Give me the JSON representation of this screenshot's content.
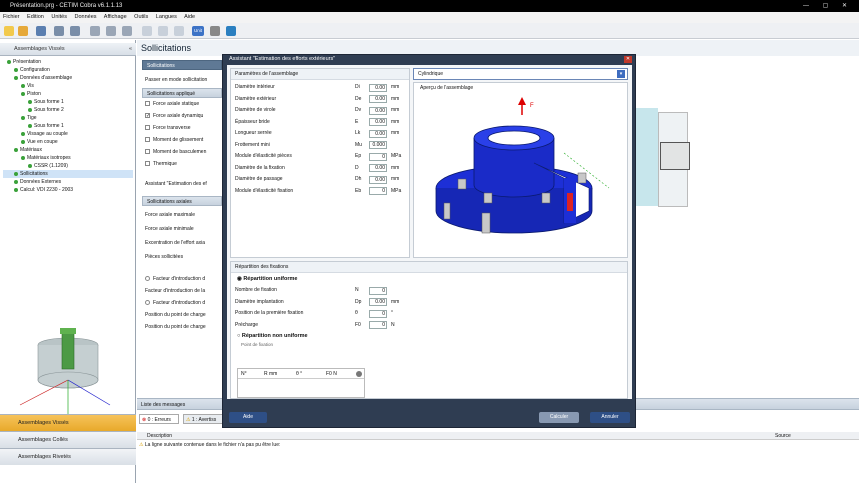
{
  "window": {
    "title": "Présentation.prg - CETIM Cobra v6.1.1.13"
  },
  "menu": [
    "Fichier",
    "Edition",
    "Unités",
    "Données",
    "Affichage",
    "Outils",
    "Langues",
    "Aide"
  ],
  "toolbar": {
    "unit_label": "Unit"
  },
  "left_panel": {
    "header": "Assemblages Vissés",
    "tree": [
      {
        "label": "Présentation",
        "level": 0
      },
      {
        "label": "Configuration",
        "level": 1
      },
      {
        "label": "Données d'assemblage",
        "level": 1
      },
      {
        "label": "Vis",
        "level": 2
      },
      {
        "label": "Piston",
        "level": 2
      },
      {
        "label": "Sous forme 1",
        "level": 3
      },
      {
        "label": "Sous forme 2",
        "level": 3
      },
      {
        "label": "Tige",
        "level": 2
      },
      {
        "label": "Sous forme 1",
        "level": 3
      },
      {
        "label": "Vissage au couple",
        "level": 2
      },
      {
        "label": "Vue en coupe",
        "level": 2
      },
      {
        "label": "Matériaux",
        "level": 1
      },
      {
        "label": "Matériaux isotropes",
        "level": 2
      },
      {
        "label": "CSSR (1.1209)",
        "level": 3
      },
      {
        "label": "Sollicitations",
        "level": 1
      },
      {
        "label": "Données Externes",
        "level": 1
      },
      {
        "label": "Calcul: VDI 2230 - 2003",
        "level": 1
      }
    ],
    "nav": [
      "Assemblages Vissés",
      "Assemblages Collés",
      "Assemblages Rivetés"
    ]
  },
  "main": {
    "title": "Sollicitations",
    "sub_header": "Sollicitations",
    "mode_text": "Passer en mode sollicitation",
    "applied_header": "Sollicitations appliqué",
    "applied": [
      {
        "label": "Force axiale statique",
        "checked": false
      },
      {
        "label": "Force axiale dynamiqu",
        "checked": true
      },
      {
        "label": "Force transverse",
        "checked": false
      },
      {
        "label": "Moment de glissement",
        "checked": false
      },
      {
        "label": "Moment de basculemen",
        "checked": false
      },
      {
        "label": "Thermique",
        "checked": false
      }
    ],
    "assistant_text": "Assistant \"Estimation des ef",
    "axial_header": "Sollicitations axiales",
    "axial": [
      "Force axiale maximale",
      "Force axiale minimale",
      "Excentration de l'effort axia",
      "Pièces sollicitées"
    ],
    "intro": [
      "Facteur d'introduction d",
      "Facteur d'introduction de la",
      "Facteur d'introduction d",
      "Position du point de charge",
      "Position du point de charge"
    ]
  },
  "messages": {
    "header": "Liste des messages",
    "tabs": [
      "0 : Erreurs",
      "1 : Avertiss"
    ],
    "col_desc": "Description",
    "col_source": "Source",
    "rows": [
      "La ligne suivante contenue dans le fichier n'a pas pu être lue:"
    ]
  },
  "dialog": {
    "title": "Assistant \"Estimation des efforts extérieurs\"",
    "params_header": "Paramètres de l'assemblage",
    "params": [
      {
        "label": "Diamètre intérieur",
        "sym": "Di",
        "val": "0.00",
        "unit": "mm"
      },
      {
        "label": "Diamètre extérieur",
        "sym": "De",
        "val": "0.00",
        "unit": "mm"
      },
      {
        "label": "Diamètre de virole",
        "sym": "Dv",
        "val": "0.00",
        "unit": "mm"
      },
      {
        "label": "Épaisseur bride",
        "sym": "E",
        "val": "0.00",
        "unit": "mm"
      },
      {
        "label": "Longueur serrée",
        "sym": "Lk",
        "val": "0.00",
        "unit": "mm"
      },
      {
        "label": "Frottement mini",
        "sym": "Mu",
        "val": "0.000",
        "unit": ""
      },
      {
        "label": "Module d'élasticité pièces",
        "sym": "Ep",
        "val": "0",
        "unit": "MPa"
      },
      {
        "label": "Diamètre de la fixation",
        "sym": "D",
        "val": "0.00",
        "unit": "mm"
      },
      {
        "label": "Diamètre de passage",
        "sym": "Dh",
        "val": "0.00",
        "unit": "mm"
      },
      {
        "label": "Module d'élasticité fixation",
        "sym": "Eb",
        "val": "0",
        "unit": "MPa"
      }
    ],
    "shape_select": "Cylindrique",
    "preview_label": "Aperçu de l'assemblage",
    "dist_header": "Répartition des fixations",
    "uniform_label": "Répartition uniforme",
    "uniform": [
      {
        "label": "Nombre de fixation",
        "sym": "N",
        "val": "0",
        "unit": ""
      },
      {
        "label": "Diamètre implantation",
        "sym": "Dp",
        "val": "0.00",
        "unit": "mm"
      },
      {
        "label": "Position de la première fixation",
        "sym": "θ",
        "val": "0",
        "unit": "°"
      },
      {
        "label": "Précharge",
        "sym": "F0",
        "val": "0",
        "unit": "N"
      }
    ],
    "nonuniform_label": "Répartition non uniforme",
    "point_label": "Point de fixation",
    "grid_cols": [
      "N°",
      "R mm",
      "θ °",
      "F0 N"
    ],
    "buttons": {
      "help": "Aide",
      "calc": "Calculer",
      "cancel": "Annuler"
    }
  },
  "colors": {
    "accent": "#1f4e9a",
    "flange": "#1d2fd6",
    "dialog_frame": "#2f3d52"
  }
}
